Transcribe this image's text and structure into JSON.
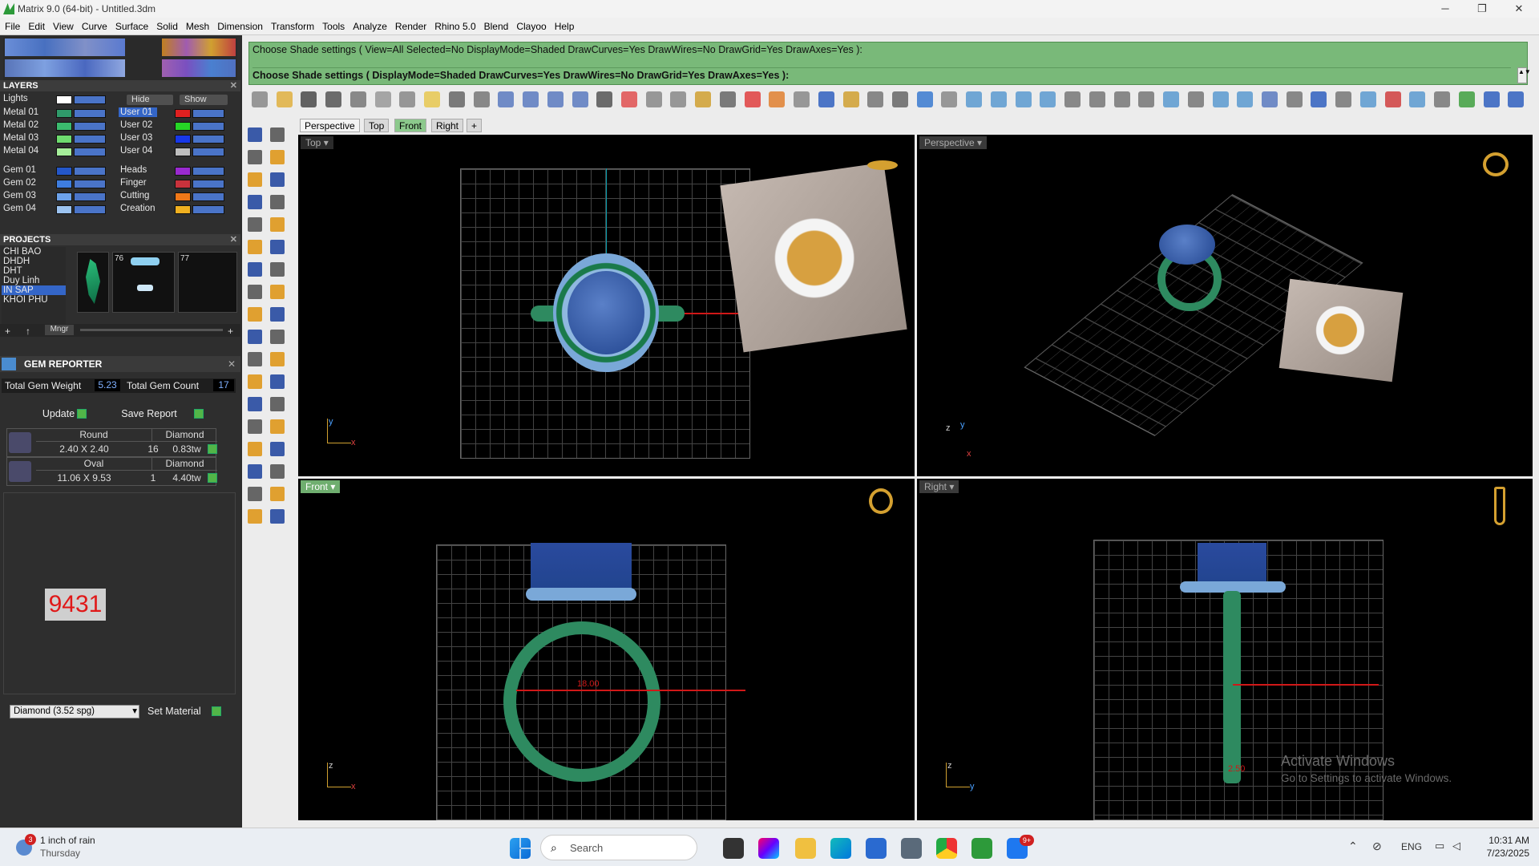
{
  "window": {
    "title": "Matrix 9.0 (64-bit) - Untitled.3dm",
    "min": "─",
    "max": "❐",
    "close": "✕"
  },
  "menu": [
    "File",
    "Edit",
    "View",
    "Curve",
    "Surface",
    "Solid",
    "Mesh",
    "Dimension",
    "Transform",
    "Tools",
    "Analyze",
    "Render",
    "Rhino 5.0",
    "Blend",
    "Clayoo",
    "Help"
  ],
  "layers": {
    "header": "LAYERS",
    "lights": "Lights",
    "hide": "Hide",
    "show": "Show",
    "left": [
      {
        "name": "Metal 01",
        "color": "#2f9a6a"
      },
      {
        "name": "Metal 02",
        "color": "#3bbb6e"
      },
      {
        "name": "Metal 03",
        "color": "#6fdc6f"
      },
      {
        "name": "Metal 04",
        "color": "#a6ee9a"
      },
      {
        "name": "Gem 01",
        "color": "#2457c9"
      },
      {
        "name": "Gem 02",
        "color": "#3e7de0"
      },
      {
        "name": "Gem 03",
        "color": "#6da2ea"
      },
      {
        "name": "Gem 04",
        "color": "#9cc3f0"
      }
    ],
    "right": [
      {
        "name": "User 01",
        "color": "#e02020",
        "selected": true
      },
      {
        "name": "User 02",
        "color": "#26d626"
      },
      {
        "name": "User 03",
        "color": "#1838e8"
      },
      {
        "name": "User 04",
        "color": "#bfbfbf"
      },
      {
        "name": "Heads",
        "color": "#9a2ad0"
      },
      {
        "name": "Finger",
        "color": "#c8323c"
      },
      {
        "name": "Cutting",
        "color": "#f07818"
      },
      {
        "name": "Creation",
        "color": "#f0b020"
      }
    ]
  },
  "projects": {
    "header": "PROJECTS",
    "items": [
      "CHI BAO",
      "DHDH",
      "DHT",
      "Duy Linh",
      "IN SAP",
      "KHOI PHU"
    ],
    "selected": "IN SAP",
    "thumb_counts": [
      "76",
      "77"
    ],
    "mngr": "Mngr"
  },
  "gem_reporter": {
    "header": "GEM REPORTER",
    "total_weight_label": "Total Gem Weight",
    "total_weight": "5.23",
    "total_count_label": "Total Gem Count",
    "total_count": "17",
    "update": "Update",
    "save_report": "Save Report",
    "rows": [
      {
        "shape": "Round",
        "material": "Diamond",
        "size": "2.40 X 2.40",
        "count": "16",
        "weight": "0.83tw"
      },
      {
        "shape": "Oval",
        "material": "Diamond",
        "size": "11.06 X 9.53",
        "count": "1",
        "weight": "4.40tw"
      }
    ],
    "badge": "9431",
    "material_select": "Diamond    (3.52 spg)",
    "set_material": "Set Material"
  },
  "command": {
    "line1": "Choose Shade settings ( View=All  Selected=No  DisplayMode=Shaded  DrawCurves=Yes  DrawWires=No  DrawGrid=Yes  DrawAxes=Yes ):",
    "line2": "Choose Shade settings ( DisplayMode=Shaded  DrawCurves=Yes  DrawWires=No  DrawGrid=Yes  DrawAxes=Yes ):"
  },
  "tabs": [
    "Perspective",
    "Top",
    "Front",
    "Right",
    "+"
  ],
  "viewports": [
    {
      "label": "Top",
      "axes": [
        "y",
        "x"
      ]
    },
    {
      "label": "Perspective",
      "axes": [
        "z",
        "y",
        "x"
      ]
    },
    {
      "label": "Front",
      "axes": [
        "z",
        "x"
      ],
      "dimension": "18.00"
    },
    {
      "label": "Right",
      "axes": [
        "z",
        "y"
      ],
      "dimension": "2.50"
    }
  ],
  "watermark": {
    "title": "Activate Windows",
    "sub": "Go to Settings to activate Windows."
  },
  "taskbar": {
    "weather": "1 inch of rain",
    "day": "Thursday",
    "weather_badge": "3",
    "search": "Search",
    "lang": "ENG",
    "time": "10:31 AM",
    "date": "7/23/2025",
    "chat_badge": "9+"
  }
}
